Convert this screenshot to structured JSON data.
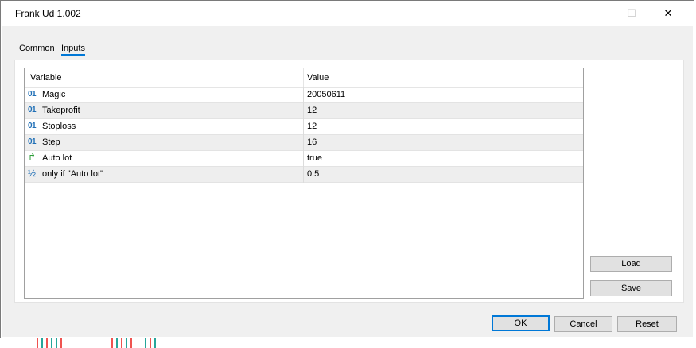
{
  "window": {
    "title": "Frank Ud 1.002",
    "minimize_glyph": "—",
    "maximize_glyph": "☐",
    "close_glyph": "✕"
  },
  "tabs": [
    {
      "label": "Common",
      "active": false
    },
    {
      "label": "Inputs",
      "active": true
    }
  ],
  "grid": {
    "columns": [
      "Variable",
      "Value"
    ],
    "rows": [
      {
        "icon": "integer-type-icon",
        "icon_glyph": "01",
        "variable": "Magic",
        "value": "20050611"
      },
      {
        "icon": "integer-type-icon",
        "icon_glyph": "01",
        "variable": "Takeprofit",
        "value": "12"
      },
      {
        "icon": "integer-type-icon",
        "icon_glyph": "01",
        "variable": "Stoploss",
        "value": "12"
      },
      {
        "icon": "integer-type-icon",
        "icon_glyph": "01",
        "variable": "Step",
        "value": "16"
      },
      {
        "icon": "boolean-type-icon",
        "icon_glyph": "↱",
        "variable": "Auto lot",
        "value": "true"
      },
      {
        "icon": "double-type-icon",
        "icon_glyph": "½",
        "variable": "only if \"Auto lot\"",
        "value": "0.5"
      }
    ]
  },
  "buttons": {
    "load": "Load",
    "save": "Save",
    "ok": "OK",
    "cancel": "Cancel",
    "reset": "Reset"
  },
  "colors": {
    "accent": "#0078d7",
    "integer_icon": "#1f6fb6",
    "boolean_icon": "#2e9e3a",
    "candle_up": "#26a69a",
    "candle_down": "#ef5350"
  }
}
